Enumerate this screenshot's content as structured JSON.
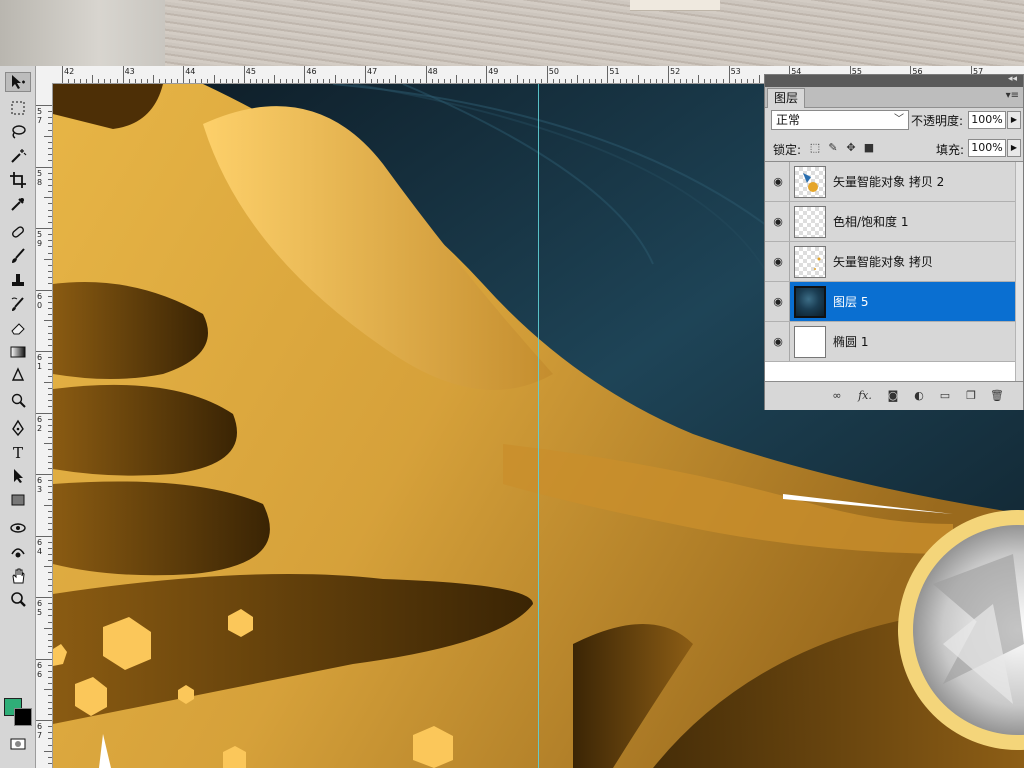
{
  "ruler": {
    "top_numbers": [
      "42",
      "43",
      "44",
      "45",
      "46",
      "47",
      "48",
      "49",
      "50",
      "51",
      "52",
      "53",
      "54",
      "55",
      "56",
      "57"
    ],
    "left_numbers": [
      "5 7",
      "5 8",
      "5 9",
      "6 0",
      "6 1",
      "6 2",
      "6 3",
      "6 4",
      "6 5",
      "6 6",
      "6 7"
    ]
  },
  "toolbar": {
    "tools": [
      "move-tool",
      "marquee-tool",
      "lasso-tool",
      "magic-wand-tool",
      "crop-tool",
      "eyedropper-tool",
      "healing-brush-tool",
      "brush-tool",
      "clone-stamp-tool",
      "history-brush-tool",
      "eraser-tool",
      "gradient-tool",
      "blur-tool",
      "dodge-tool",
      "pen-tool",
      "type-tool",
      "path-selection-tool",
      "rectangle-tool",
      "3d-rotate-tool",
      "3d-orbit-tool",
      "hand-tool",
      "zoom-tool"
    ],
    "foreground_color": "#2fae78",
    "background_color": "#000000"
  },
  "layers_panel": {
    "tab_label": "图层",
    "blend_mode": "正常",
    "opacity_label": "不透明度:",
    "opacity_value": "100%",
    "lock_label": "锁定:",
    "fill_label": "填充:",
    "fill_value": "100%",
    "layers": [
      {
        "name": "矢量智能对象 拷贝 2",
        "selected": false
      },
      {
        "name": "色相/饱和度 1",
        "selected": false
      },
      {
        "name": "矢量智能对象 拷贝",
        "selected": false
      },
      {
        "name": "图层 5",
        "selected": true
      },
      {
        "name": "椭圆 1",
        "selected": false
      }
    ],
    "bottom_icons": [
      "link-layers-icon",
      "fx-icon",
      "add-mask-icon",
      "adjustment-layer-icon",
      "new-group-icon",
      "new-layer-icon",
      "trash-icon"
    ],
    "fx_label": "fx."
  },
  "colors": {
    "gold_light": "#f3c14e",
    "gold_dark": "#6a4408",
    "navy": "#14303f",
    "selection_blue": "#0a6fd1",
    "guide_cyan": "#5fd0d6"
  }
}
